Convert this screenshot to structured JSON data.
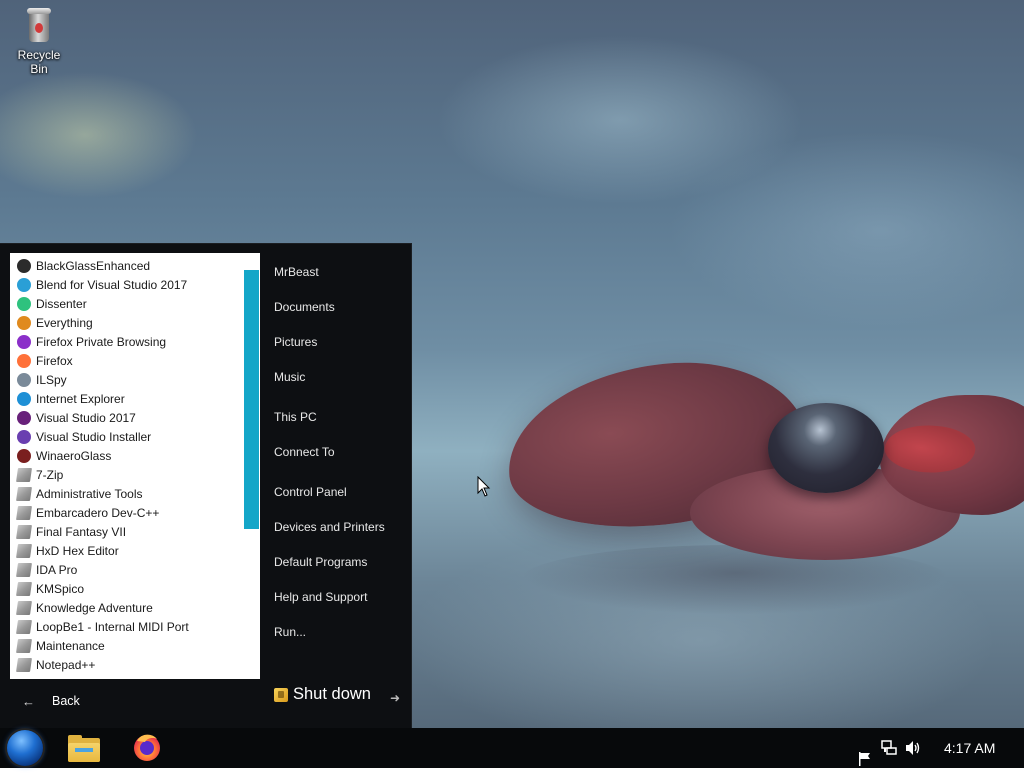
{
  "desktop": {
    "icons": [
      {
        "label": "Recycle Bin",
        "icon": "recycle-bin-icon"
      }
    ]
  },
  "start_menu": {
    "programs": [
      {
        "label": "BlackGlassEnhanced",
        "icon": "black-circle-icon",
        "color": "#2b2b2b"
      },
      {
        "label": "Blend for Visual Studio 2017",
        "icon": "blend-icon",
        "color": "#2a9fd6"
      },
      {
        "label": "Dissenter",
        "icon": "dissenter-icon",
        "color": "#2ec27e"
      },
      {
        "label": "Everything",
        "icon": "magnifier-icon",
        "color": "#e08a1e"
      },
      {
        "label": "Firefox Private Browsing",
        "icon": "firefox-private-icon",
        "color": "#8b2fc9"
      },
      {
        "label": "Firefox",
        "icon": "firefox-icon",
        "color": "#ff7139"
      },
      {
        "label": "ILSpy",
        "icon": "ilspy-icon",
        "color": "#7a8a99"
      },
      {
        "label": "Internet Explorer",
        "icon": "internet-explorer-icon",
        "color": "#1e90d6"
      },
      {
        "label": "Visual Studio 2017",
        "icon": "visual-studio-icon",
        "color": "#68217a"
      },
      {
        "label": "Visual Studio Installer",
        "icon": "visual-studio-installer-icon",
        "color": "#6a3fb0"
      },
      {
        "label": "WinaeroGlass",
        "icon": "winaero-glass-icon",
        "color": "#7a1f1f"
      },
      {
        "label": "7-Zip",
        "icon": "folder-icon",
        "color": "#8a8a8a"
      },
      {
        "label": "Administrative Tools",
        "icon": "folder-icon",
        "color": "#8a8a8a"
      },
      {
        "label": "Embarcadero Dev-C++",
        "icon": "folder-icon",
        "color": "#8a8a8a"
      },
      {
        "label": "Final Fantasy VII",
        "icon": "folder-icon",
        "color": "#8a8a8a"
      },
      {
        "label": "HxD Hex Editor",
        "icon": "folder-icon",
        "color": "#8a8a8a"
      },
      {
        "label": "IDA Pro",
        "icon": "folder-icon",
        "color": "#8a8a8a"
      },
      {
        "label": "KMSpico",
        "icon": "folder-icon",
        "color": "#8a8a8a"
      },
      {
        "label": "Knowledge Adventure",
        "icon": "folder-icon",
        "color": "#8a8a8a"
      },
      {
        "label": "LoopBe1 - Internal MIDI Port",
        "icon": "folder-icon",
        "color": "#8a8a8a"
      },
      {
        "label": "Maintenance",
        "icon": "folder-icon",
        "color": "#8a8a8a"
      },
      {
        "label": "Notepad++",
        "icon": "folder-icon",
        "color": "#8a8a8a"
      }
    ],
    "back_label": "Back",
    "places": [
      {
        "label": "MrBeast"
      },
      {
        "label": "Documents"
      },
      {
        "label": "Pictures"
      },
      {
        "label": "Music"
      },
      {
        "label": "This PC"
      },
      {
        "label": "Connect To"
      },
      {
        "label": "Control Panel"
      },
      {
        "label": "Devices and Printers"
      },
      {
        "label": "Default Programs"
      },
      {
        "label": "Help and Support"
      },
      {
        "label": "Run..."
      }
    ],
    "shutdown_label": "Shut down",
    "accent_color": "#14a6c8"
  },
  "taskbar": {
    "pinned": [
      {
        "name": "file-explorer-icon"
      },
      {
        "name": "firefox-icon"
      }
    ],
    "tray_icons": [
      "action-center-flag-icon",
      "network-icon",
      "volume-icon"
    ],
    "clock": "4:17 AM"
  }
}
